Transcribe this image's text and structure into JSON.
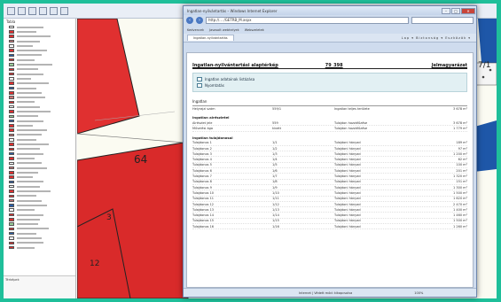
{
  "gis": {
    "toc_title": "Tabla",
    "toc_footer": "Térképek"
  },
  "map": {
    "labels": [
      "64",
      "3",
      "12",
      "7/1"
    ]
  },
  "browser": {
    "title": "Ingatlan-nyilvántartás – Windows Internet Explorer",
    "url": "http://... /GETRB_M.aspx",
    "fav_items": [
      "Kedvencek",
      "Javasolt webhelyek",
      "Webszeletek"
    ],
    "tab_label": "Ingatlan-nyilvántartás",
    "tab_cmds": "Lap ▾  Biztonság ▾  Eszközök ▾",
    "status": [
      "Internet | Védett mód: kikapcsolva",
      "100%"
    ]
  },
  "page": {
    "head_title": "Ingatlan-nyilvántartási alaptérkép",
    "head_id": "79_398",
    "head_right": "Jelmagyarázat",
    "links": [
      "Ingatlan adatainak listázása",
      "Nyomtatás"
    ],
    "section": "Ingatlan",
    "kv": [
      "Helyrajzi szám",
      "559/1",
      "Ingatlan teljes területe",
      "3 678 m²"
    ],
    "sub1": "Ingatlan alrészletei",
    "sub1_rows": [
      [
        "Alrészlet jele",
        "559",
        "Tulajdon hozzáfűzése",
        "3 678 m²"
      ],
      [
        "Művelési ága",
        "kivett",
        "Tulajdon hozzáfűzése",
        "1 779 m²"
      ]
    ],
    "sub2": "Ingatlan tulajdonosai",
    "sub2_rows": [
      [
        "Tulajdonos 1",
        "1/1",
        "Tulajdoni hányad",
        "189 m²"
      ],
      [
        "Tulajdonos 2",
        "1/2",
        "Tulajdoni hányad",
        "97 m²"
      ],
      [
        "Tulajdonos 3",
        "1/3",
        "Tulajdoni hányad",
        "1 200 m²"
      ],
      [
        "Tulajdonos 4",
        "1/4",
        "Tulajdoni hányad",
        "62 m²"
      ],
      [
        "Tulajdonos 5",
        "1/5",
        "Tulajdoni hányad",
        "100 m²"
      ],
      [
        "Tulajdonos 6",
        "1/6",
        "Tulajdoni hányad",
        "201 m²"
      ],
      [
        "Tulajdonos 7",
        "1/7",
        "Tulajdoni hányad",
        "1 320 m²"
      ],
      [
        "Tulajdonos 8",
        "1/8",
        "Tulajdoni hányad",
        "151 m²"
      ],
      [
        "Tulajdonos 9",
        "1/9",
        "Tulajdoni hányad",
        "1 300 m²"
      ],
      [
        "Tulajdonos 10",
        "1/10",
        "Tulajdoni hányad",
        "1 500 m²"
      ],
      [
        "Tulajdonos 11",
        "1/11",
        "Tulajdoni hányad",
        "1 620 m²"
      ],
      [
        "Tulajdonos 12",
        "1/12",
        "Tulajdoni hányad",
        "2 470 m²"
      ],
      [
        "Tulajdonos 13",
        "1/13",
        "Tulajdoni hányad",
        "1 400 m²"
      ],
      [
        "Tulajdonos 14",
        "1/14",
        "Tulajdoni hányad",
        "1 460 m²"
      ],
      [
        "Tulajdonos 15",
        "1/15",
        "Tulajdoni hányad",
        "1 500 m²"
      ],
      [
        "Tulajdonos 16",
        "1/16",
        "Tulajdoni hányad",
        "1 260 m²"
      ]
    ]
  },
  "colors": {
    "parcel_red": "#e03030",
    "frame": "#1fbf9a"
  }
}
